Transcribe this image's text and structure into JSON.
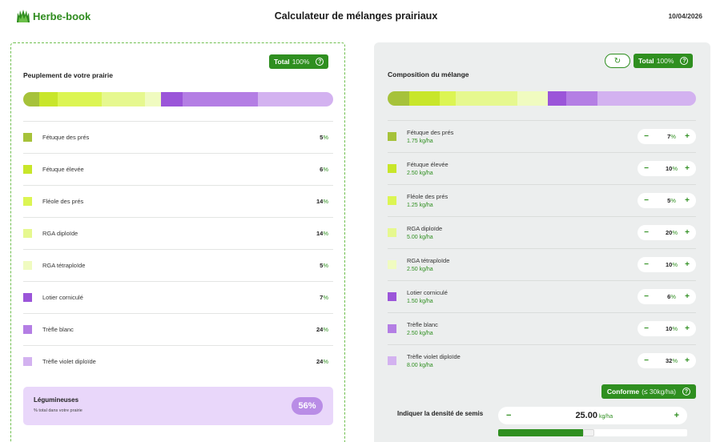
{
  "header": {
    "logo_text": "Herbe-book",
    "title": "Calculateur de mélanges prairiaux",
    "date": "10/04/2026"
  },
  "left": {
    "title": "Peuplement de votre prairie",
    "total_label": "Total",
    "total_value": "100%",
    "items": [
      {
        "name": "Fétuque des prés",
        "pct": "5",
        "color": "#a6c23a"
      },
      {
        "name": "Fétuque élevée",
        "pct": "6",
        "color": "#c8e62a"
      },
      {
        "name": "Fléole des prés",
        "pct": "14",
        "color": "#dcf553"
      },
      {
        "name": "RGA diploïde",
        "pct": "14",
        "color": "#e6f88f"
      },
      {
        "name": "RGA tétraploïde",
        "pct": "5",
        "color": "#f0fbc0"
      },
      {
        "name": "Lotier corniculé",
        "pct": "7",
        "color": "#9b55d9"
      },
      {
        "name": "Trèfle blanc",
        "pct": "24",
        "color": "#b47ee4"
      },
      {
        "name": "Trèfle violet diploïde",
        "pct": "24",
        "color": "#d3b2f0"
      }
    ],
    "unit": "%",
    "legumineuses": {
      "title": "Légumineuses",
      "subtitle": "% total dans votre prairie",
      "value": "56%"
    }
  },
  "right": {
    "title": "Composition du mélange",
    "total_label": "Total",
    "total_value": "100%",
    "items": [
      {
        "name": "Fétuque des prés",
        "rate": "1.75 kg/ha",
        "pct": "7",
        "color": "#a6c23a"
      },
      {
        "name": "Fétuque élevée",
        "rate": "2.50 kg/ha",
        "pct": "10",
        "color": "#c8e62a"
      },
      {
        "name": "Fléole des prés",
        "rate": "1.25 kg/ha",
        "pct": "5",
        "color": "#dcf553"
      },
      {
        "name": "RGA diploïde",
        "rate": "5.00 kg/ha",
        "pct": "20",
        "color": "#e6f88f"
      },
      {
        "name": "RGA tétraploïde",
        "rate": "2.50 kg/ha",
        "pct": "10",
        "color": "#f0fbc0"
      },
      {
        "name": "Lotier corniculé",
        "rate": "1.50 kg/ha",
        "pct": "6",
        "color": "#9b55d9"
      },
      {
        "name": "Trèfle blanc",
        "rate": "2.50 kg/ha",
        "pct": "10",
        "color": "#b47ee4"
      },
      {
        "name": "Trèfle violet diploïde",
        "rate": "8.00 kg/ha",
        "pct": "32",
        "color": "#d3b2f0"
      }
    ],
    "unit": "%",
    "minus": "−",
    "plus": "+",
    "conforme_label": "Conforme",
    "conforme_note": "(≤ 30kg/ha)",
    "density_label": "Indiquer la densité de semis",
    "density_value": "25.00",
    "density_unit": "kg/ha",
    "density_level": 0.45
  },
  "colors": {
    "brand_green": "#2f8f20"
  }
}
